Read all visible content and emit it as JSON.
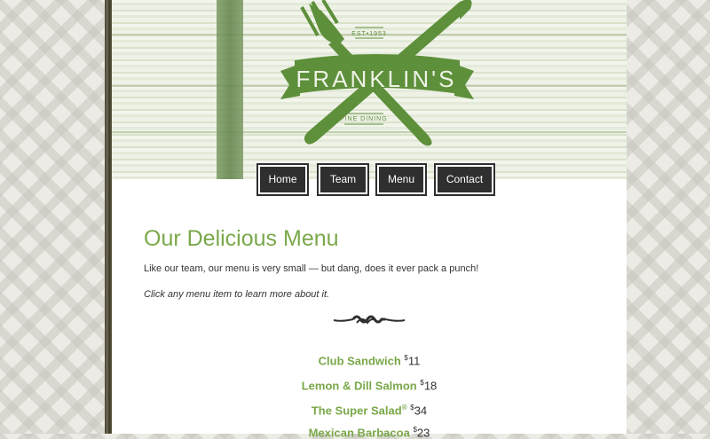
{
  "brand": {
    "name": "FRANKLIN'S",
    "established": "EST•1953",
    "tagline": "FINE DINING",
    "colors": {
      "accent": "#7aa84a",
      "nav_bg": "#2f2f2f"
    }
  },
  "nav": {
    "items": [
      {
        "label": "Home"
      },
      {
        "label": "Team"
      },
      {
        "label": "Menu"
      },
      {
        "label": "Contact"
      }
    ]
  },
  "page": {
    "title": "Our Delicious Menu",
    "intro": "Like our team, our menu is very small — but dang, does it ever pack a punch!",
    "hint": "Click any menu item to learn more about it."
  },
  "menu": {
    "items": [
      {
        "name": "Club Sandwich",
        "currency": "$",
        "price": "11"
      },
      {
        "name": "Lemon & Dill Salmon",
        "currency": "$",
        "price": "18"
      },
      {
        "name": "The Super Salad",
        "trademark": "®",
        "currency": "$",
        "price": "34"
      },
      {
        "name": "Mexican Barbacoa",
        "currency": "$",
        "price": "23"
      }
    ]
  }
}
